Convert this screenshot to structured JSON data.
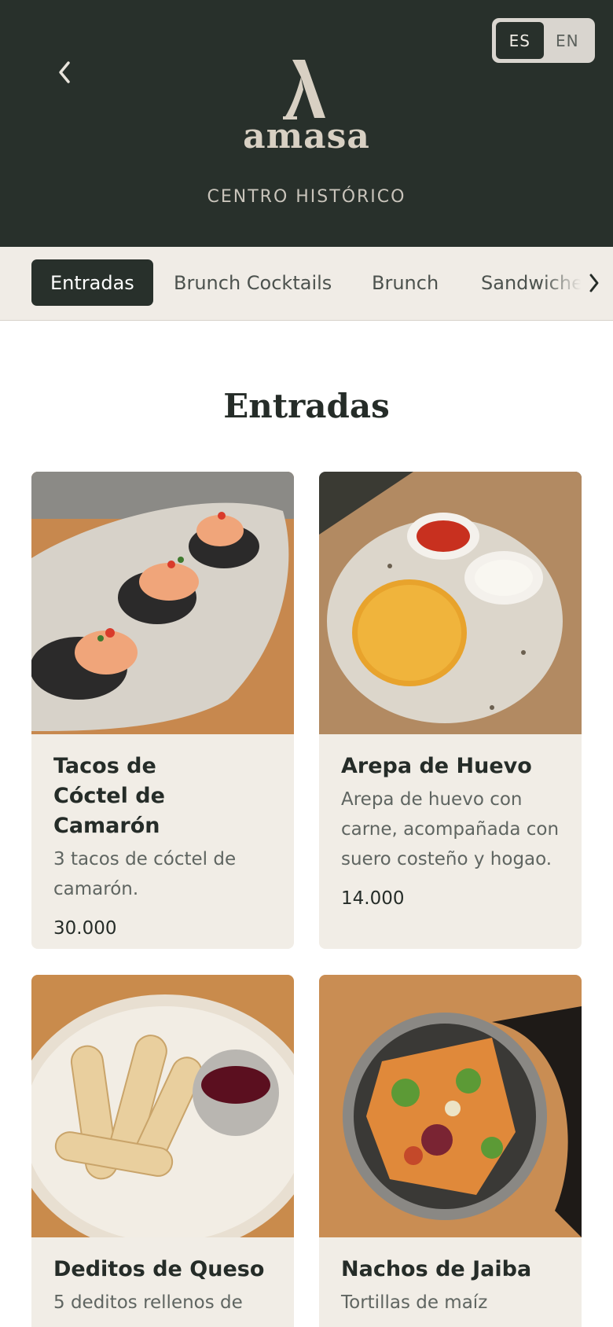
{
  "header": {
    "brand": "amasa",
    "location": "CENTRO HISTÓRICO",
    "languages": [
      {
        "label": "ES",
        "active": true
      },
      {
        "label": "EN",
        "active": false
      }
    ],
    "back_icon": "chevron-left-icon"
  },
  "tabs": [
    {
      "label": "Entradas",
      "active": true
    },
    {
      "label": "Brunch Cocktails",
      "active": false
    },
    {
      "label": "Brunch",
      "active": false
    },
    {
      "label": "Sandwiches",
      "active": false
    }
  ],
  "tabs_next_icon": "chevron-right-icon",
  "section": {
    "title": "Entradas"
  },
  "items": [
    {
      "name": "Tacos de Cóctel de Camarón",
      "description": "3 tacos de cóctel de camarón.",
      "price": "30.000"
    },
    {
      "name": "Arepa de Huevo",
      "description": "Arepa de huevo con carne, acompañada con suero costeño y hogao.",
      "price": "14.000"
    },
    {
      "name": "Deditos de Queso",
      "description": "5 deditos rellenos de",
      "price": ""
    },
    {
      "name": "Nachos de Jaiba",
      "description": "Tortillas de maíz",
      "price": ""
    }
  ],
  "colors": {
    "header_bg": "#28302b",
    "tabs_bg": "#f0ece6",
    "card_bg": "#f1ede6",
    "text_dark": "#252c28"
  }
}
